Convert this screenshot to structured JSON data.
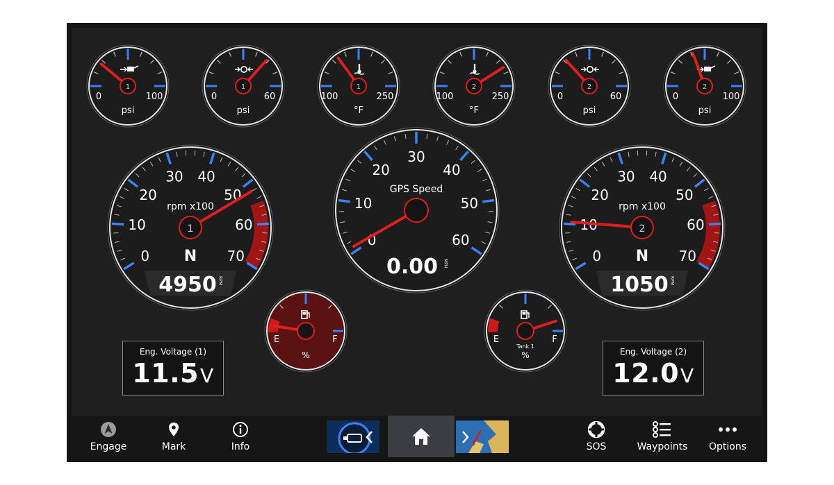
{
  "colors": {
    "accent_blue": "#3b82f6",
    "needle_red": "#e11d1d",
    "danger_red": "#a11515",
    "bg": "#1f1f1f"
  },
  "small_gauges": [
    {
      "id": "oil-pressure-1",
      "icon": "oil-can-icon",
      "min": "0",
      "max": "100",
      "unit": "psi",
      "engine": "1",
      "min_val": 0,
      "max_val": 100,
      "value": 22
    },
    {
      "id": "trans-pressure-1",
      "icon": "transmission-icon",
      "min": "0",
      "max": "60",
      "unit": "psi",
      "engine": "1",
      "min_val": 0,
      "max_val": 60,
      "value": 44
    },
    {
      "id": "coolant-temp-1",
      "icon": "thermometer-icon",
      "min": "100",
      "max": "250",
      "unit": "°F",
      "engine": "1",
      "min_val": 100,
      "max_val": 250,
      "value": 145
    },
    {
      "id": "coolant-temp-2",
      "icon": "thermometer-icon",
      "min": "100",
      "max": "250",
      "unit": "°F",
      "engine": "2",
      "min_val": 100,
      "max_val": 250,
      "value": 223
    },
    {
      "id": "trans-pressure-2",
      "icon": "transmission-icon",
      "min": "0",
      "max": "60",
      "unit": "psi",
      "engine": "2",
      "min_val": 0,
      "max_val": 60,
      "value": 16
    },
    {
      "id": "oil-pressure-2",
      "icon": "oil-can-icon",
      "min": "0",
      "max": "100",
      "unit": "psi",
      "engine": "2",
      "min_val": 0,
      "max_val": 100,
      "value": 39
    }
  ],
  "tachometers": [
    {
      "id": "tach-1",
      "label": "rpm x100",
      "engine": "1",
      "gear": "N",
      "readout": "4950",
      "readout_unit": "RPM",
      "ticks": [
        "0",
        "10",
        "20",
        "30",
        "40",
        "50",
        "60",
        "70"
      ],
      "value": 52
    },
    {
      "id": "tach-2",
      "label": "rpm x100",
      "engine": "2",
      "gear": "N",
      "readout": "1050",
      "readout_unit": "RPM",
      "ticks": [
        "0",
        "10",
        "20",
        "30",
        "40",
        "50",
        "60",
        "70"
      ],
      "value": 10.5
    }
  ],
  "speed": {
    "label": "GPS Speed",
    "readout": "0.00",
    "readout_unit": "MPH",
    "ticks": [
      "0",
      "10",
      "20",
      "30",
      "40",
      "50",
      "60"
    ],
    "value": 0
  },
  "fuel_gauges": [
    {
      "id": "fuel-1",
      "empty": "E",
      "full": "F",
      "unit": "%",
      "tank": "",
      "level": 0.05,
      "alarm": true
    },
    {
      "id": "fuel-2",
      "empty": "E",
      "full": "F",
      "unit": "%",
      "tank": "Tank 1",
      "level": 0.9,
      "alarm": false
    }
  ],
  "voltage": [
    {
      "label": "Eng. Voltage (1)",
      "value": "11.5",
      "unit": "V"
    },
    {
      "label": "Eng. Voltage (2)",
      "value": "12.0",
      "unit": "V"
    }
  ],
  "bottom_bar": {
    "engage": "Engage",
    "mark": "Mark",
    "info": "Info",
    "sos": "SOS",
    "waypoints": "Waypoints",
    "options": "Options"
  }
}
